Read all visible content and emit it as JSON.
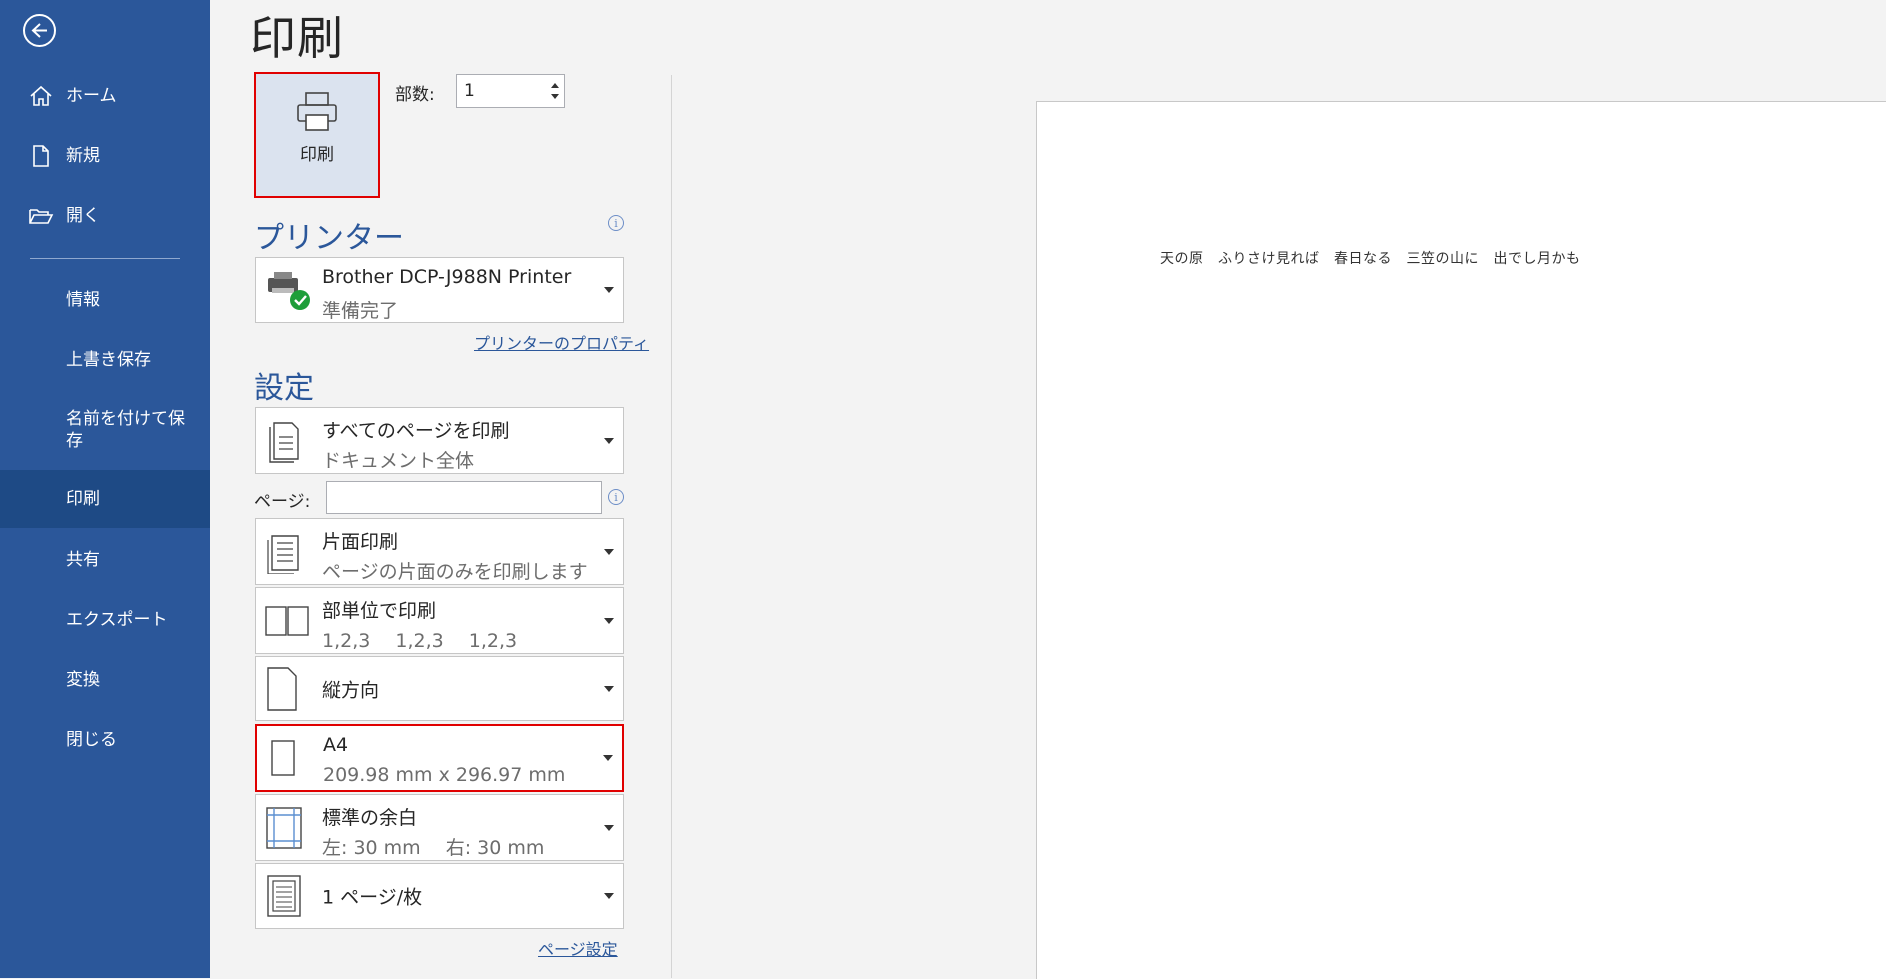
{
  "nav": {
    "items": [
      {
        "label": "ホーム",
        "icon": "home-icon"
      },
      {
        "label": "新規",
        "icon": "new-document-icon"
      },
      {
        "label": "開く",
        "icon": "folder-open-icon"
      },
      {
        "label": "情報"
      },
      {
        "label": "上書き保存"
      },
      {
        "label": "名前を付けて保存"
      },
      {
        "label": "印刷"
      },
      {
        "label": "共有"
      },
      {
        "label": "エクスポート"
      },
      {
        "label": "変換"
      },
      {
        "label": "閉じる"
      }
    ],
    "active": "印刷"
  },
  "title": "印刷",
  "print_button": {
    "label": "印刷"
  },
  "copies": {
    "label": "部数:",
    "value": "1"
  },
  "printer": {
    "heading": "プリンター",
    "name": "Brother DCP-J988N Printer",
    "status": "準備完了",
    "properties_link": "プリンターのプロパティ"
  },
  "settings": {
    "heading": "設定",
    "range": {
      "title": "すべてのページを印刷",
      "subtitle": "ドキュメント全体"
    },
    "pages": {
      "label": "ページ:",
      "value": ""
    },
    "sides": {
      "title": "片面印刷",
      "subtitle": "ページの片面のみを印刷します"
    },
    "collate": {
      "title": "部単位で印刷",
      "subtitle": "1,2,3　 1,2,3　 1,2,3"
    },
    "orientation": {
      "title": "縦方向"
    },
    "paper_size": {
      "title": "A4",
      "subtitle": "209.98 mm x 296.97 mm"
    },
    "margins": {
      "title": "標準の余白",
      "subtitle": "左:  30 mm　  右:  30 mm"
    },
    "per_sheet": {
      "title": "1 ページ/枚"
    },
    "page_setup_link": "ページ設定"
  },
  "preview": {
    "text": "天の原　ふりさけ見れば　春日なる　三笠の山に　出でし月かも"
  },
  "colors": {
    "nav_bg": "#2b579a",
    "highlight_border": "#e00000",
    "accent": "#2b579a"
  }
}
